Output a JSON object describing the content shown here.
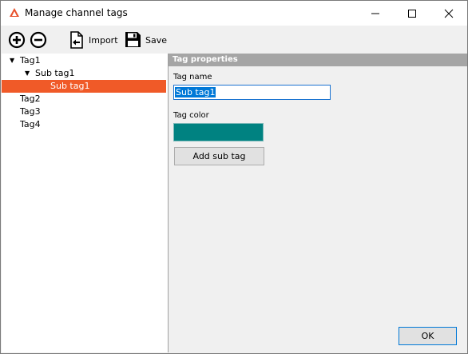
{
  "window": {
    "title": "Manage channel tags",
    "accent_color": "#f05a28"
  },
  "toolbar": {
    "import_label": "Import",
    "save_label": "Save"
  },
  "tree": {
    "items": [
      {
        "label": "Tag1",
        "expanded": true,
        "level": 0
      },
      {
        "label": "Sub tag1",
        "expanded": true,
        "level": 1
      },
      {
        "label": "Sub tag1",
        "level": 2,
        "selected": true
      },
      {
        "label": "Tag2",
        "level": 0
      },
      {
        "label": "Tag3",
        "level": 0
      },
      {
        "label": "Tag4",
        "level": 0
      }
    ]
  },
  "properties": {
    "header": "Tag properties",
    "name_label": "Tag name",
    "name_value": "Sub tag1",
    "color_label": "Tag color",
    "color_value": "#008281",
    "add_sub_tag_label": "Add sub tag"
  },
  "footer": {
    "ok_label": "OK"
  }
}
